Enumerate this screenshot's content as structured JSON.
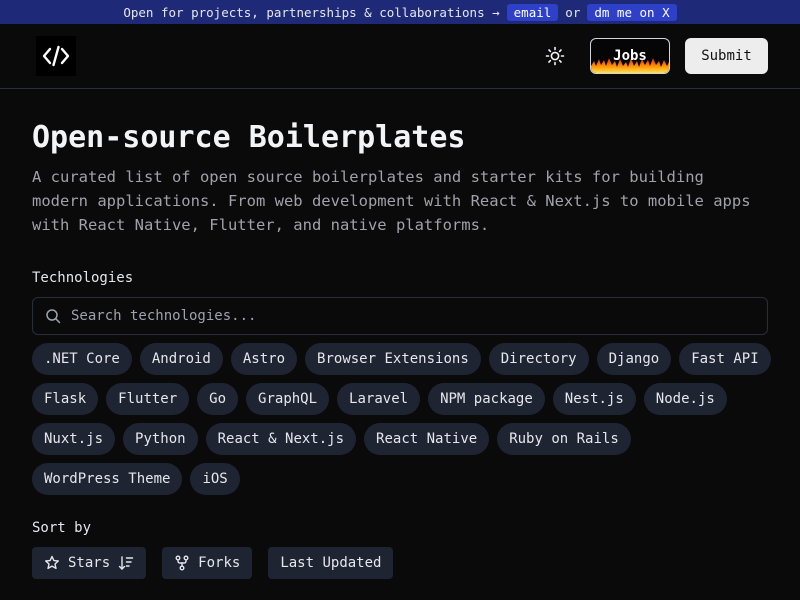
{
  "banner": {
    "text": "Open for projects, partnerships & collaborations →",
    "email_label": "email",
    "or_text": "or",
    "dm_label": "dm me on X"
  },
  "header": {
    "logo_icon": "code-brackets-icon",
    "theme_icon": "sun-icon",
    "jobs_label": "Jobs",
    "submit_label": "Submit"
  },
  "hero": {
    "title": "Open-source Boilerplates",
    "description": "A curated list of open source boilerplates and starter kits for building modern applications. From web development with React & Next.js to mobile apps with React Native, Flutter, and native platforms."
  },
  "technologies": {
    "label": "Technologies",
    "search_placeholder": "Search technologies...",
    "tags": [
      ".NET Core",
      "Android",
      "Astro",
      "Browser Extensions",
      "Directory",
      "Django",
      "Fast API",
      "Flask",
      "Flutter",
      "Go",
      "GraphQL",
      "Laravel",
      "NPM package",
      "Nest.js",
      "Node.js",
      "Nuxt.js",
      "Python",
      "React & Next.js",
      "React Native",
      "Ruby on Rails",
      "WordPress Theme",
      "iOS"
    ]
  },
  "sort": {
    "label": "Sort by",
    "options": [
      {
        "label": "Stars",
        "icon": "star-icon",
        "suffix_icon": "sort-descending-icon"
      },
      {
        "label": "Forks",
        "icon": "git-fork-icon"
      },
      {
        "label": "Last Updated"
      }
    ]
  },
  "colors": {
    "background": "#0a0a0b",
    "banner": "#1e2a78",
    "banner_pill": "#2f40c8",
    "tag_bg": "#1f2433",
    "submit_bg": "#ededed"
  }
}
